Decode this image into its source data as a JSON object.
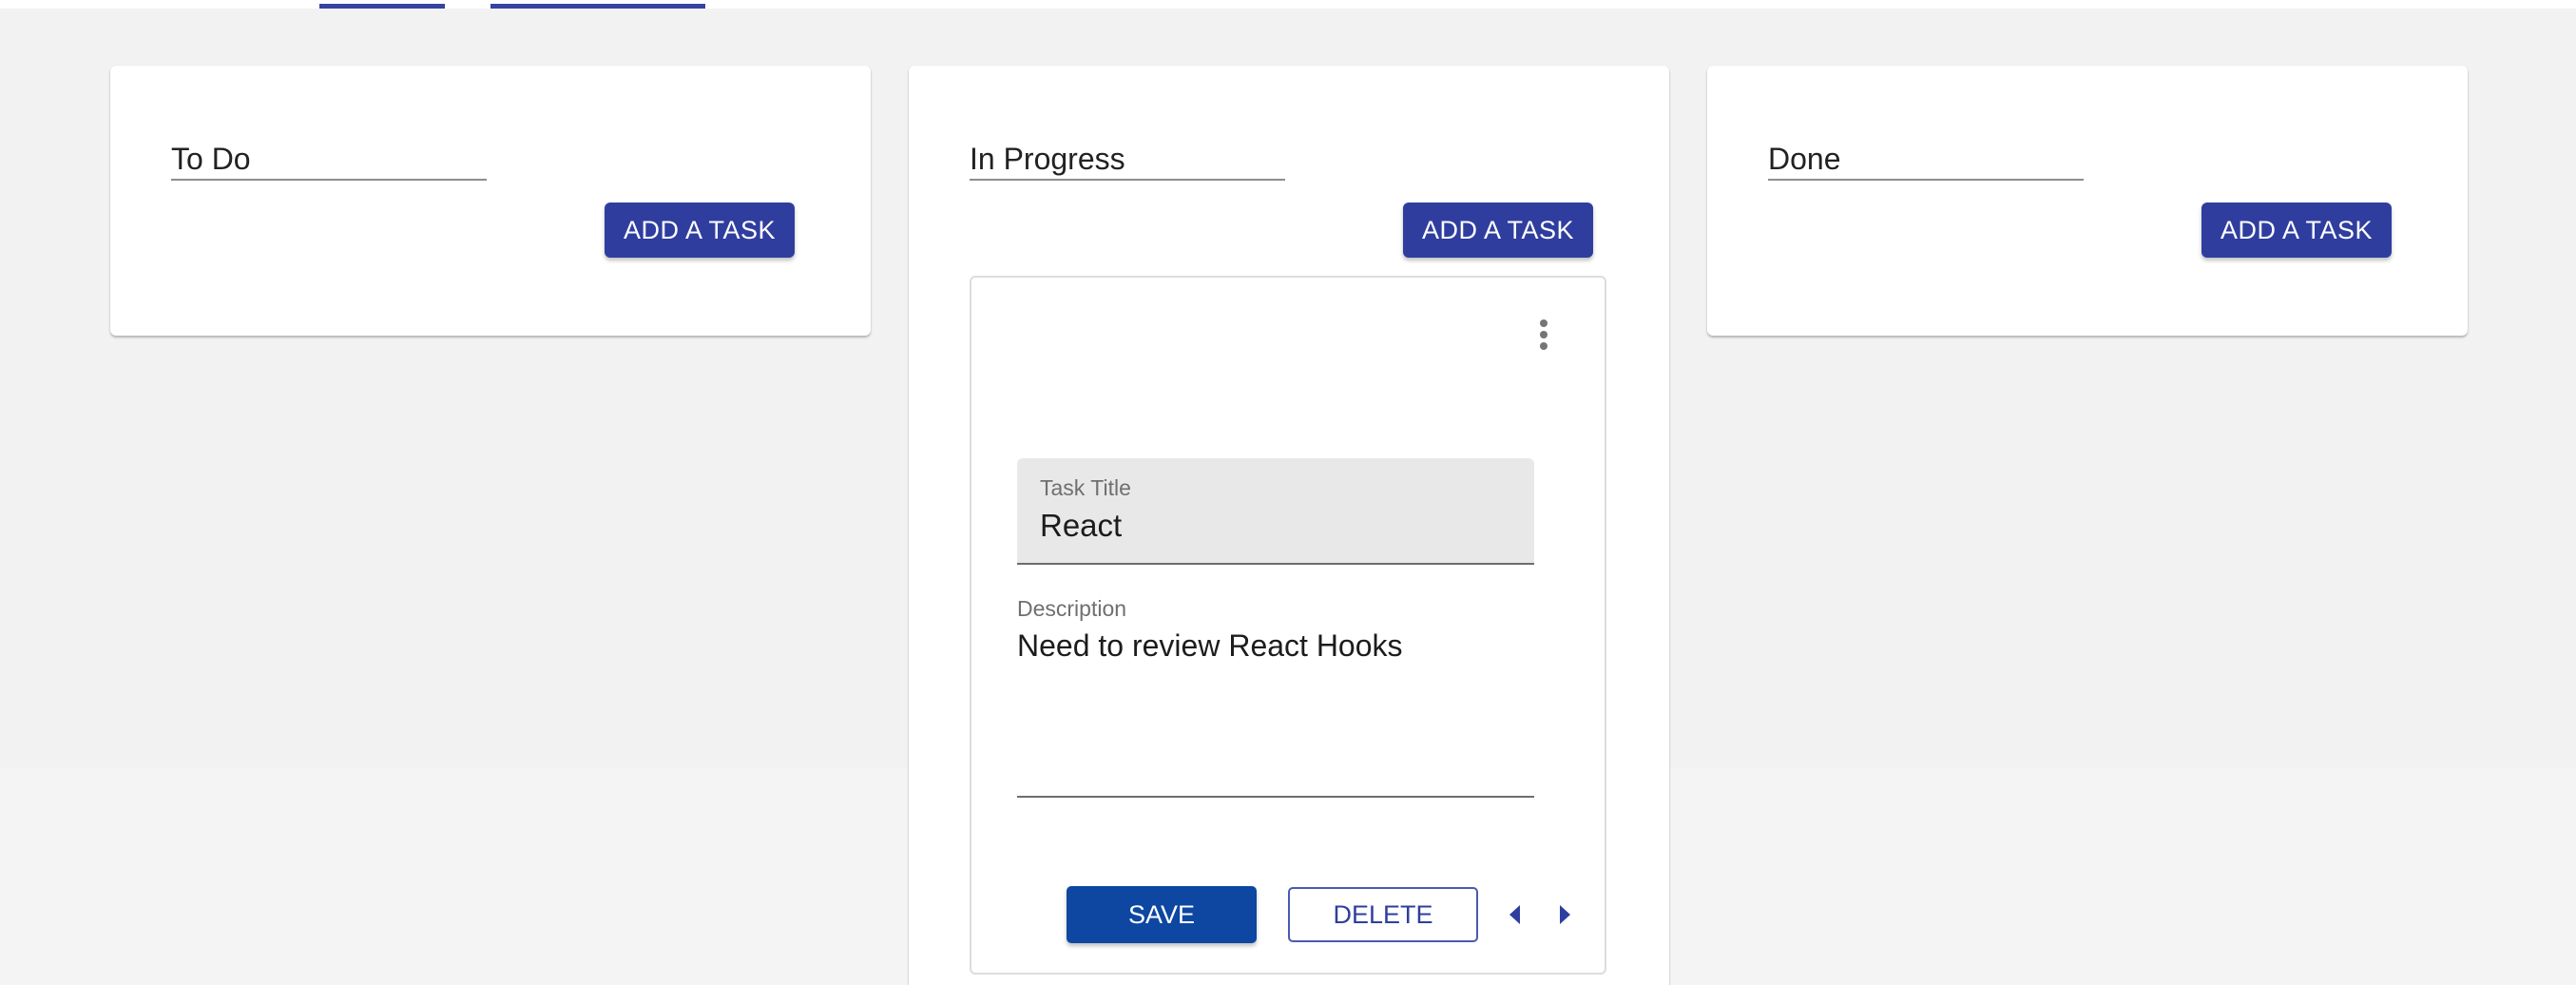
{
  "nav": {
    "active_tabs": [
      "tab-1",
      "tab-2"
    ],
    "accent_color": "#3444a0"
  },
  "columns": [
    {
      "title": "To Do",
      "add_label": "ADD A TASK"
    },
    {
      "title": "In Progress",
      "add_label": "ADD A TASK"
    },
    {
      "title": "Done",
      "add_label": "ADD A TASK"
    }
  ],
  "task": {
    "menu_icon": "more-vertical-icon",
    "title_label": "Task Title",
    "title_value": "React",
    "description_label": "Description",
    "description_value": "Need to review React Hooks",
    "save_label": "SAVE",
    "delete_label": "DELETE",
    "prev_icon": "arrow-left-icon",
    "next_icon": "arrow-right-icon"
  },
  "colors": {
    "primary": "#2f3e9e",
    "save": "#0d47a1",
    "background": "#f2f2f2"
  }
}
